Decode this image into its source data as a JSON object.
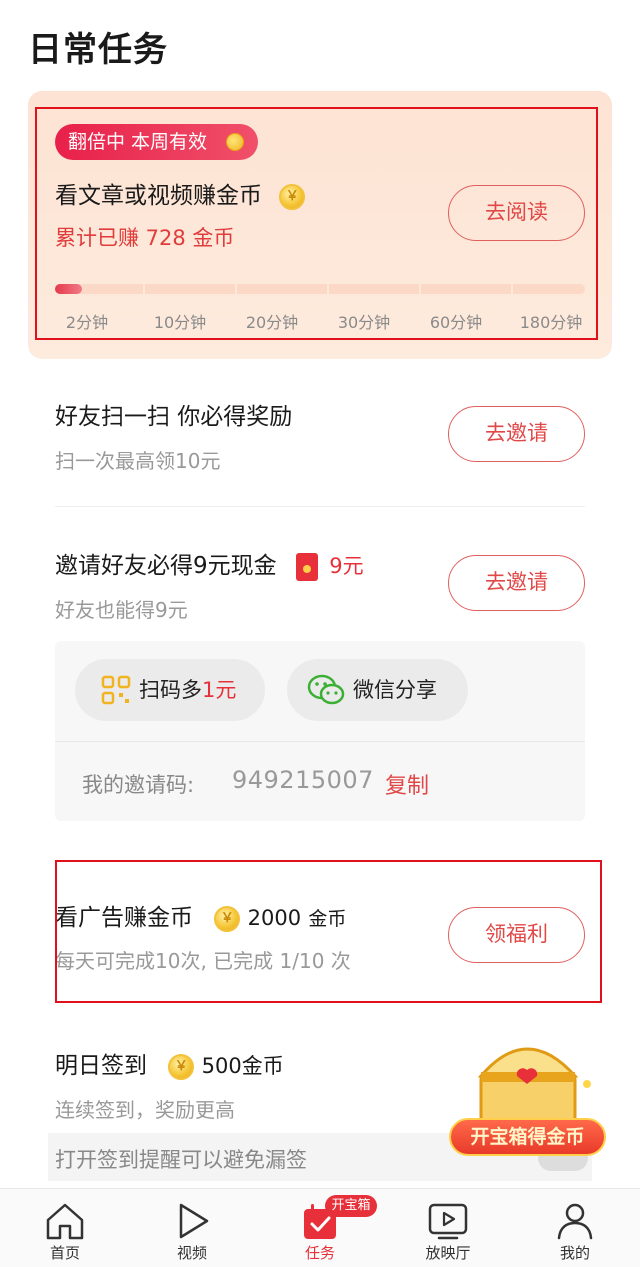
{
  "page": {
    "title": "日常任务"
  },
  "read_task": {
    "badge": "翻倍中 本周有效",
    "title": "看文章或视频赚金币",
    "coin_symbol": "￥",
    "earned_text": "累计已赚 728 金币",
    "button": "去阅读",
    "progress_fraction": 0.05,
    "milestones": [
      "2分钟",
      "10分钟",
      "20分钟",
      "30分钟",
      "60分钟",
      "180分钟"
    ]
  },
  "scan_task": {
    "title": "好友扫一扫 你必得奖励",
    "subtitle": "扫一次最高领10元",
    "button": "去邀请"
  },
  "invite_task": {
    "title": "邀请好友必得9元现金",
    "reward": "9元",
    "subtitle": "好友也能得9元",
    "button": "去邀请",
    "share_qr_prefix": "扫码多",
    "share_qr_highlight": "1元",
    "share_wechat": "微信分享",
    "invite_code_label": "我的邀请码:",
    "invite_code": "949215007",
    "copy": "复制"
  },
  "ad_task": {
    "title": "看广告赚金币",
    "reward_amount": "2000",
    "reward_unit": "金币",
    "subtitle": "每天可完成10次, 已完成 1/10 次",
    "button": "领福利"
  },
  "signin_task": {
    "title": "明日签到",
    "reward": "500金币",
    "subtitle": "连续签到，奖励更高",
    "reminder": "打开签到提醒可以避免漏签"
  },
  "treasure": {
    "banner": "开宝箱得金币"
  },
  "tabbar": {
    "items": [
      {
        "label": "首页",
        "icon": "home-icon"
      },
      {
        "label": "视频",
        "icon": "play-icon"
      },
      {
        "label": "任务",
        "icon": "task-calendar-icon",
        "active": true
      },
      {
        "label": "放映厅",
        "icon": "theater-icon"
      },
      {
        "label": "我的",
        "icon": "person-icon"
      }
    ],
    "task_badge": "开宝箱"
  },
  "colors": {
    "accent": "#e8303a",
    "button_border": "#e06060",
    "progress": "#e53a4a"
  }
}
